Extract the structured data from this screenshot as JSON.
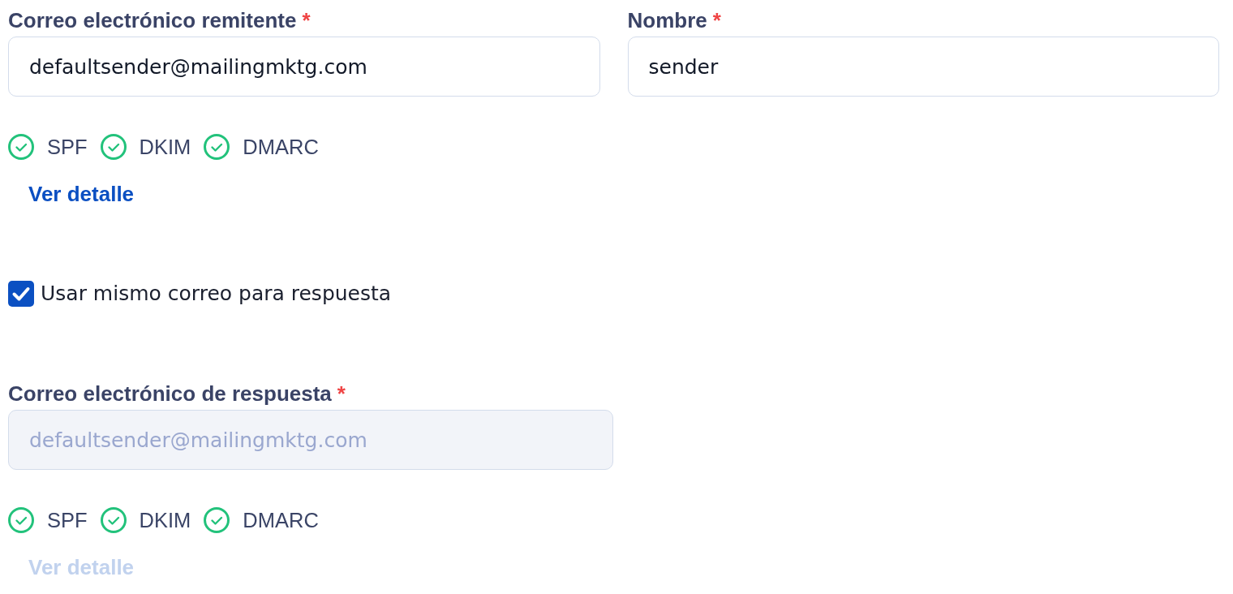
{
  "sender_fields": [
    {
      "label": "Correo electrónico remitente",
      "required_mark": "*",
      "value": "defaultsender@mailingmktg.com",
      "disabled": false,
      "checks": [
        {
          "label": "SPF",
          "passed": true
        },
        {
          "label": "DKIM",
          "passed": true
        },
        {
          "label": "DMARC",
          "passed": true
        }
      ],
      "detail_link": {
        "label": "Ver detalle",
        "disabled": false
      }
    },
    {
      "label": "Nombre",
      "required_mark": "*",
      "value": "sender",
      "disabled": false
    }
  ],
  "same_reply_checkbox": {
    "label": "Usar mismo correo para respuesta",
    "checked": true
  },
  "reply_field": {
    "label": "Correo electrónico de respuesta",
    "required_mark": "*",
    "value": "defaultsender@mailingmktg.com",
    "disabled": true,
    "checks": [
      {
        "label": "SPF",
        "passed": true
      },
      {
        "label": "DKIM",
        "passed": true
      },
      {
        "label": "DMARC",
        "passed": true
      }
    ],
    "detail_link": {
      "label": "Ver detalle",
      "disabled": true
    }
  }
}
